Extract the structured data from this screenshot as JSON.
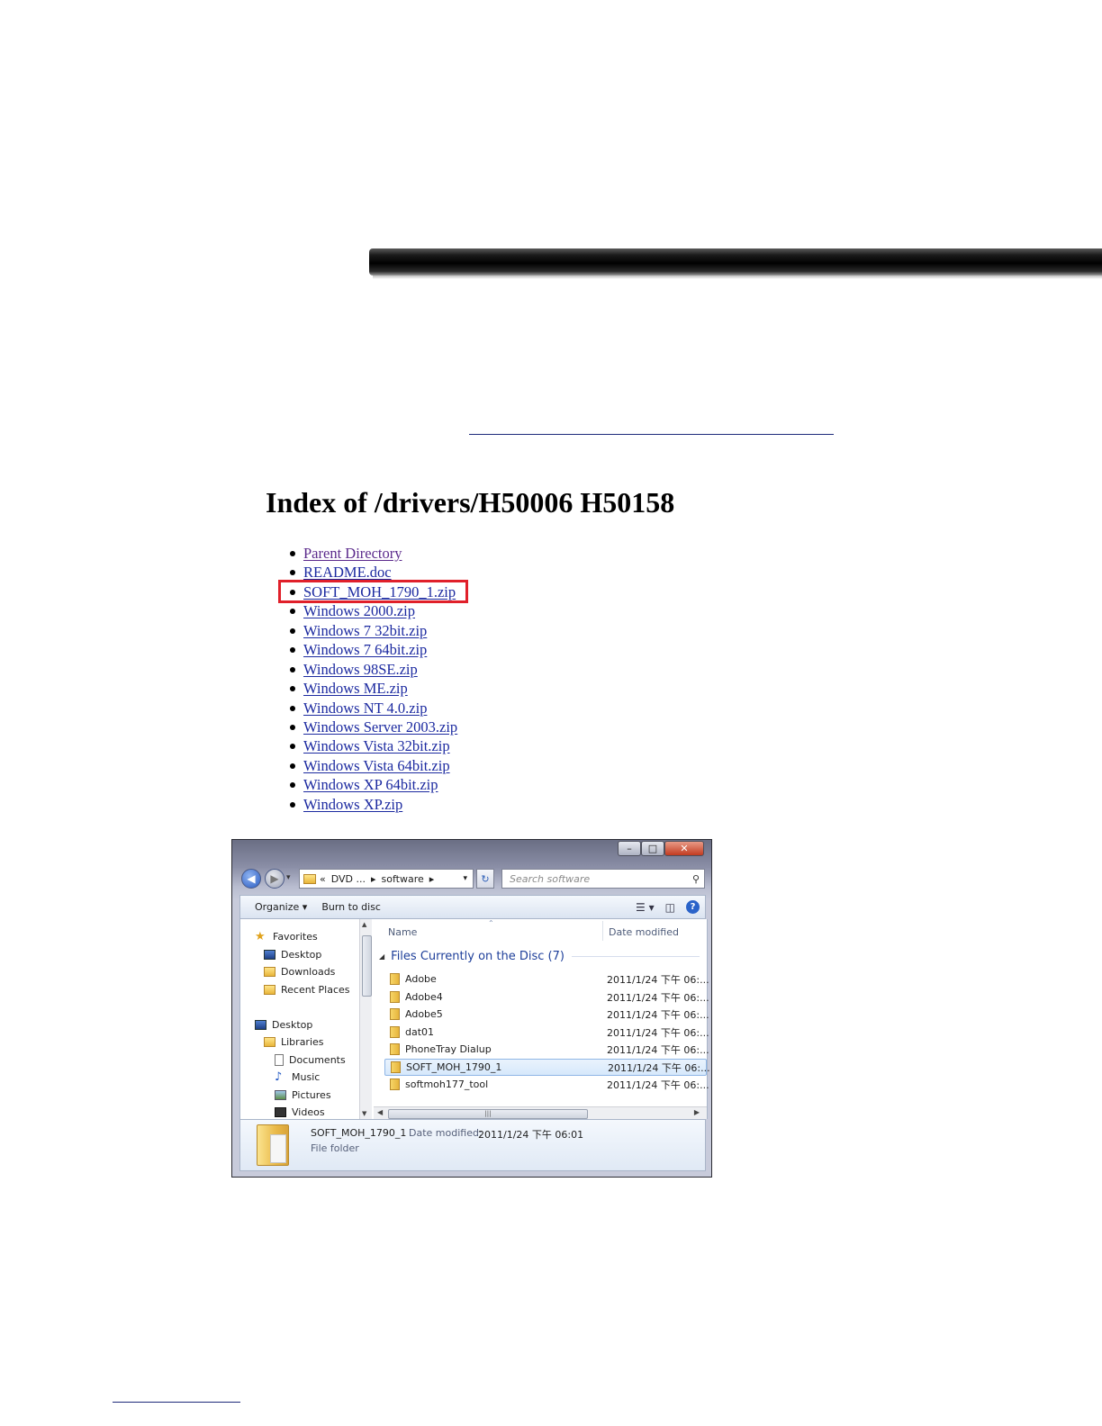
{
  "index": {
    "title": "Index of /drivers/H50006 H50158",
    "files": [
      "Parent Directory",
      "README.doc",
      "SOFT_MOH_1790_1.zip",
      "Windows 2000.zip",
      "Windows 7 32bit.zip",
      "Windows 7 64bit.zip",
      "Windows 98SE.zip",
      "Windows ME.zip",
      "Windows NT 4.0.zip",
      "Windows Server 2003.zip",
      "Windows Vista 32bit.zip",
      "Windows Vista 64bit.zip",
      "Windows XP 64bit.zip",
      "Windows XP.zip"
    ],
    "highlighted_file": "SOFT_MOH_1790_1.zip",
    "colors": {
      "link": "#1c2aa0",
      "visited": "#5b2a8c",
      "highlight": "#e0202a"
    }
  },
  "explorer": {
    "window_buttons": {
      "minimize": "–",
      "maximize": "□",
      "close": "✕"
    },
    "address": {
      "prefix": "«",
      "crumb1": "DVD ...",
      "sep1": "▸",
      "crumb2": "software",
      "sep2": "▸"
    },
    "search_placeholder": "Search software",
    "toolbar": {
      "organize": "Organize ▾",
      "burn": "Burn to disc"
    },
    "nav": {
      "favorites": "Favorites",
      "desktop_fav": "Desktop",
      "downloads": "Downloads",
      "recent_places": "Recent Places",
      "desktop": "Desktop",
      "libraries": "Libraries",
      "documents": "Documents",
      "music": "Music",
      "pictures": "Pictures",
      "videos": "Videos"
    },
    "columns": {
      "name": "Name",
      "date_modified": "Date modified"
    },
    "group_header": "Files Currently on the Disc (7)",
    "files": [
      {
        "name": "Adobe",
        "date": "2011/1/24 下午 06:..."
      },
      {
        "name": "Adobe4",
        "date": "2011/1/24 下午 06:..."
      },
      {
        "name": "Adobe5",
        "date": "2011/1/24 下午 06:..."
      },
      {
        "name": "dat01",
        "date": "2011/1/24 下午 06:..."
      },
      {
        "name": "PhoneTray Dialup",
        "date": "2011/1/24 下午 06:..."
      },
      {
        "name": "SOFT_MOH_1790_1",
        "date": "2011/1/24 下午 06:..."
      },
      {
        "name": "softmoh177_tool",
        "date": "2011/1/24 下午 06:..."
      }
    ],
    "selected_file": "SOFT_MOH_1790_1",
    "details": {
      "name": "SOFT_MOH_1790_1",
      "date_label": "Date modified:",
      "date": "2011/1/24 下午 06:01",
      "type": "File folder"
    }
  }
}
